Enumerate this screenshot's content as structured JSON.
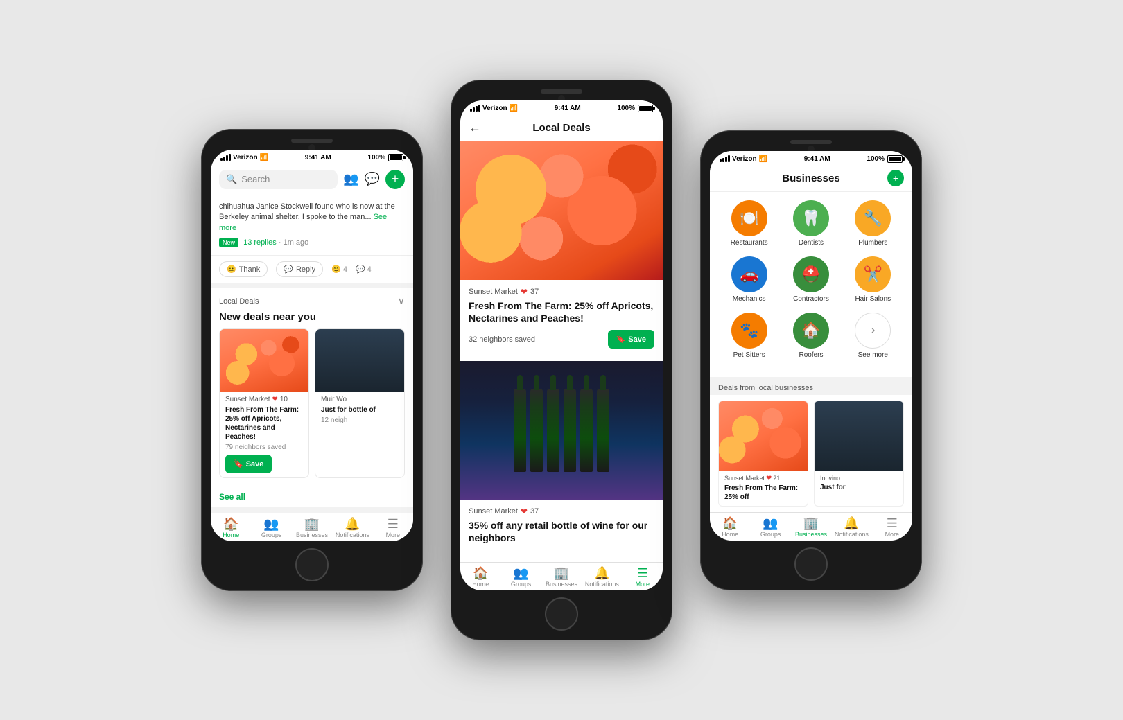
{
  "page": {
    "background": "#e8e8e8"
  },
  "phone1": {
    "status": {
      "carrier": "Verizon",
      "time": "9:41 AM",
      "battery": "100%"
    },
    "header": {
      "search_placeholder": "Search"
    },
    "post": {
      "text": "chihuahua Janice Stockwell found who is now at the Berkeley animal shelter. I spoke to the man...",
      "see_more": "See more",
      "badge": "New",
      "replies": "13 replies",
      "time": "1m ago"
    },
    "actions": {
      "thank": "Thank",
      "reply": "Reply",
      "reactions": "4",
      "comments": "4"
    },
    "deals": {
      "section_label": "Local Deals",
      "heading": "New deals near you",
      "card1": {
        "store": "Sunset Market",
        "hearts": "10",
        "description": "Fresh From The Farm: 25% off Apricots, Nectarines and Peaches!",
        "saved": "79 neighbors saved",
        "save_btn": "Save"
      },
      "card2": {
        "store": "Muir Wo",
        "description": "Just for bottle of",
        "saved": "12 neigh"
      },
      "see_all": "See all"
    },
    "nav": {
      "home": "Home",
      "groups": "Groups",
      "businesses": "Businesses",
      "notifications": "Notifications",
      "more": "More"
    }
  },
  "phone2": {
    "status": {
      "carrier": "Verizon",
      "time": "9:41 AM",
      "battery": "100%"
    },
    "header": {
      "title": "Local Deals",
      "back": "←"
    },
    "deal1": {
      "store": "Sunset Market",
      "hearts": "37",
      "description": "Fresh From The Farm: 25% off Apricots, Nectarines and Peaches!",
      "saved": "32 neighbors saved",
      "save_btn": "Save"
    },
    "deal2": {
      "store": "Sunset Market",
      "hearts": "37",
      "description": "35% off any retail bottle of wine for our neighbors"
    },
    "nav": {
      "home": "Home",
      "groups": "Groups",
      "businesses": "Businesses",
      "notifications": "Notifications",
      "more": "More"
    }
  },
  "phone3": {
    "status": {
      "carrier": "Verizon",
      "time": "9:41 AM",
      "battery": "100%"
    },
    "header": {
      "title": "Businesses"
    },
    "categories": {
      "row1": [
        {
          "label": "Restaurants",
          "icon": "🍽️",
          "color": "#f57c00"
        },
        {
          "label": "Dentists",
          "icon": "🦷",
          "color": "#4caf50"
        },
        {
          "label": "Plumbers",
          "icon": "🔧",
          "color": "#f9a825"
        }
      ],
      "row2": [
        {
          "label": "Mechanics",
          "icon": "🚗",
          "color": "#1976d2"
        },
        {
          "label": "Contractors",
          "icon": "⛑️",
          "color": "#388e3c"
        },
        {
          "label": "Hair Salons",
          "icon": "✂️",
          "color": "#f9a825"
        }
      ],
      "row3": [
        {
          "label": "Pet Sitters",
          "icon": "🐾",
          "color": "#f57c00"
        },
        {
          "label": "Roofers",
          "icon": "🏠",
          "color": "#388e3c"
        },
        {
          "label": "See more",
          "icon": "›",
          "color": "none"
        }
      ]
    },
    "deals_section_label": "Deals from local businesses",
    "deal1": {
      "store": "Sunset Market",
      "hearts": "21",
      "description": "Fresh From The Farm: 25% off"
    },
    "deal2": {
      "store": "Inovino",
      "description": "Just for"
    },
    "nav": {
      "home": "Home",
      "groups": "Groups",
      "businesses": "Businesses",
      "notifications": "Notifications",
      "more": "More"
    }
  }
}
